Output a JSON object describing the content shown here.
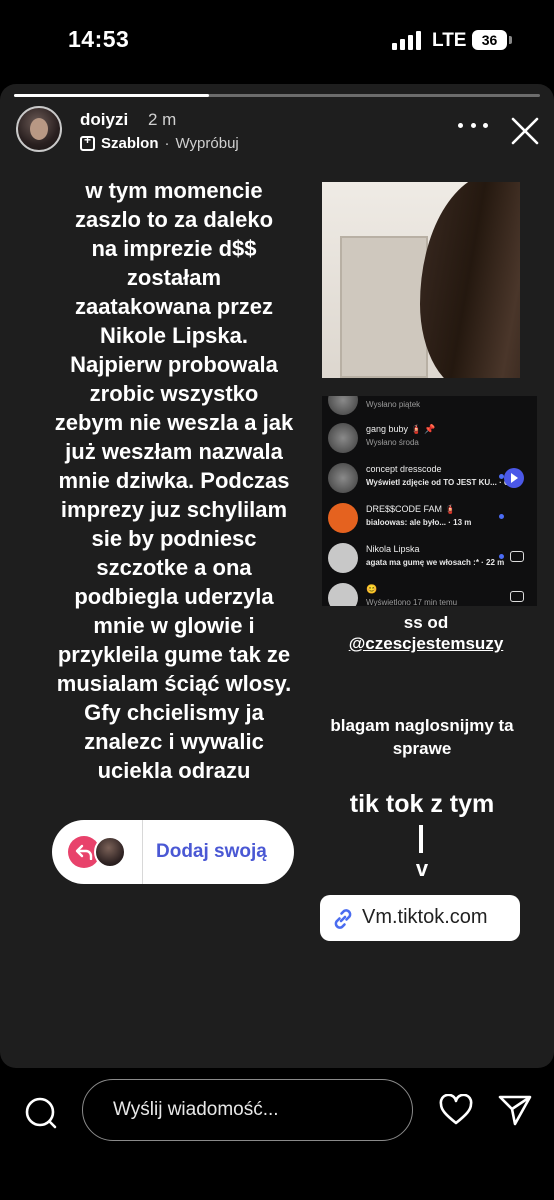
{
  "status_bar": {
    "time": "14:53",
    "carrier": "LTE",
    "battery": "36"
  },
  "story": {
    "progress": 0.37,
    "username": "doiyzi",
    "time_ago": "2 m",
    "template_label": "Szablon",
    "separator": "·",
    "try_label": "Wypróbuj",
    "main_text": "w tym momencie\nzaszlo to za daleko\nna imprezie d$$\nzostałam\nzaatakowana przez\nNikole Lipska.\nNajpierw probowala\nzrobic wszystko\nzebym nie weszla a jak\njuż weszłam nazwala\nmnie dziwka. Podczas\nimprezy juz schylilam\nsie by podniesc\nszczotke a ona\npodbiegla uderzyla\nmnie w glowie i\nprzykleila gume tak ze\nmusialam ściąć wlosy.\nGfy chcielismy ja\nznalezc i wywalic\nuciekla odrazu",
    "add_yours_label": "Dodaj swoją",
    "ss_label": "ss od",
    "ss_mention": "@czescjestemsuzy",
    "plea": "blagam naglosnijmy ta sprawe",
    "tiktok_label": "tik tok z tym",
    "arrow_label": "v",
    "link_label": "Vm.tiktok.com",
    "dm_screenshot": [
      {
        "name": "",
        "sub": "Wysłano piątek",
        "bold": false,
        "avatar": "dark",
        "dot": false,
        "action": ""
      },
      {
        "name": "gang buby 🧯 📌",
        "sub": "Wysłano środa",
        "bold": false,
        "avatar": "dark",
        "dot": false,
        "action": ""
      },
      {
        "name": "concept dresscode",
        "sub": "Wyświetl zdjęcie od TO JEST KU... · 6 m",
        "bold": true,
        "avatar": "dark",
        "dot": true,
        "action": "play"
      },
      {
        "name": "DRE$$CODE FAM 🧯",
        "sub": "bialoowas: ale było... · 13 m",
        "bold": true,
        "avatar": "orange",
        "dot": true,
        "action": ""
      },
      {
        "name": "Nikola Lipska",
        "sub": "agata ma gumę we włosach :* · 22 m",
        "bold": true,
        "avatar": "grey",
        "dot": true,
        "action": "camera"
      },
      {
        "name": "😊",
        "sub": "Wyświetlono 17 min temu",
        "bold": false,
        "avatar": "grey",
        "dot": false,
        "action": "camera"
      }
    ]
  },
  "bottom_bar": {
    "message_placeholder": "Wyślij wiadomość..."
  },
  "icons": {
    "camera": "camera-icon",
    "heart": "heart-icon",
    "send": "send-icon",
    "close": "close-icon",
    "more": "more-icon",
    "link": "link-icon"
  },
  "colors": {
    "add_yours_accent": "#e8426b",
    "add_yours_text": "#4a58d4",
    "story_background": "#1e1e1e"
  }
}
